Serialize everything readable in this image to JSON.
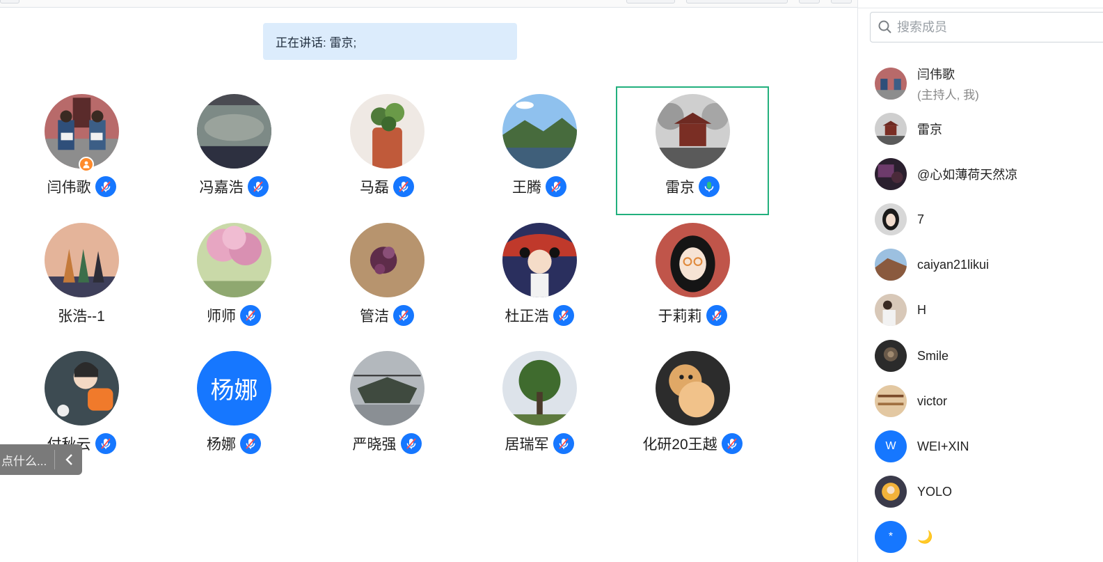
{
  "speaking_banner": {
    "text": "正在讲话: 雷京;"
  },
  "participants": [
    {
      "name": "闫伟歌",
      "mic": "muted",
      "host": true
    },
    {
      "name": "冯嘉浩",
      "mic": "muted"
    },
    {
      "name": "马磊",
      "mic": "muted"
    },
    {
      "name": "王腾",
      "mic": "muted"
    },
    {
      "name": "雷京",
      "mic": "active",
      "speaking": true
    },
    {
      "name": "张浩--1",
      "mic": "none"
    },
    {
      "name": "师师",
      "mic": "muted"
    },
    {
      "name": "管洁",
      "mic": "muted"
    },
    {
      "name": "杜正浩",
      "mic": "muted"
    },
    {
      "name": "于莉莉",
      "mic": "muted"
    },
    {
      "name": "付秋云",
      "mic": "muted"
    },
    {
      "name": "杨娜",
      "mic": "muted",
      "avatar_text": "杨娜"
    },
    {
      "name": "严晓强",
      "mic": "muted"
    },
    {
      "name": "居瑞军",
      "mic": "muted"
    },
    {
      "name": "化研20王越",
      "mic": "muted"
    }
  ],
  "floating_input": {
    "placeholder": "点什么..."
  },
  "member_panel": {
    "search_placeholder": "搜索成员",
    "members": [
      {
        "name": "闫伟歌",
        "role": "(主持人, 我)"
      },
      {
        "name": "雷京"
      },
      {
        "name": "@心如薄荷天然凉"
      },
      {
        "name": "7"
      },
      {
        "name": "caiyan21likui"
      },
      {
        "name": "H"
      },
      {
        "name": "Smile"
      },
      {
        "name": "victor"
      },
      {
        "name": "WEI+XIN",
        "avatar_text": "W"
      },
      {
        "name": "YOLO"
      },
      {
        "name": "🌙",
        "avatar_text": "*"
      }
    ]
  },
  "colors": {
    "accent": "#1677ff",
    "active_mic": "#2ec27e",
    "speaking_border": "#22b07d",
    "banner_bg": "#dcecfc",
    "host_badge": "#ff8a2b"
  }
}
